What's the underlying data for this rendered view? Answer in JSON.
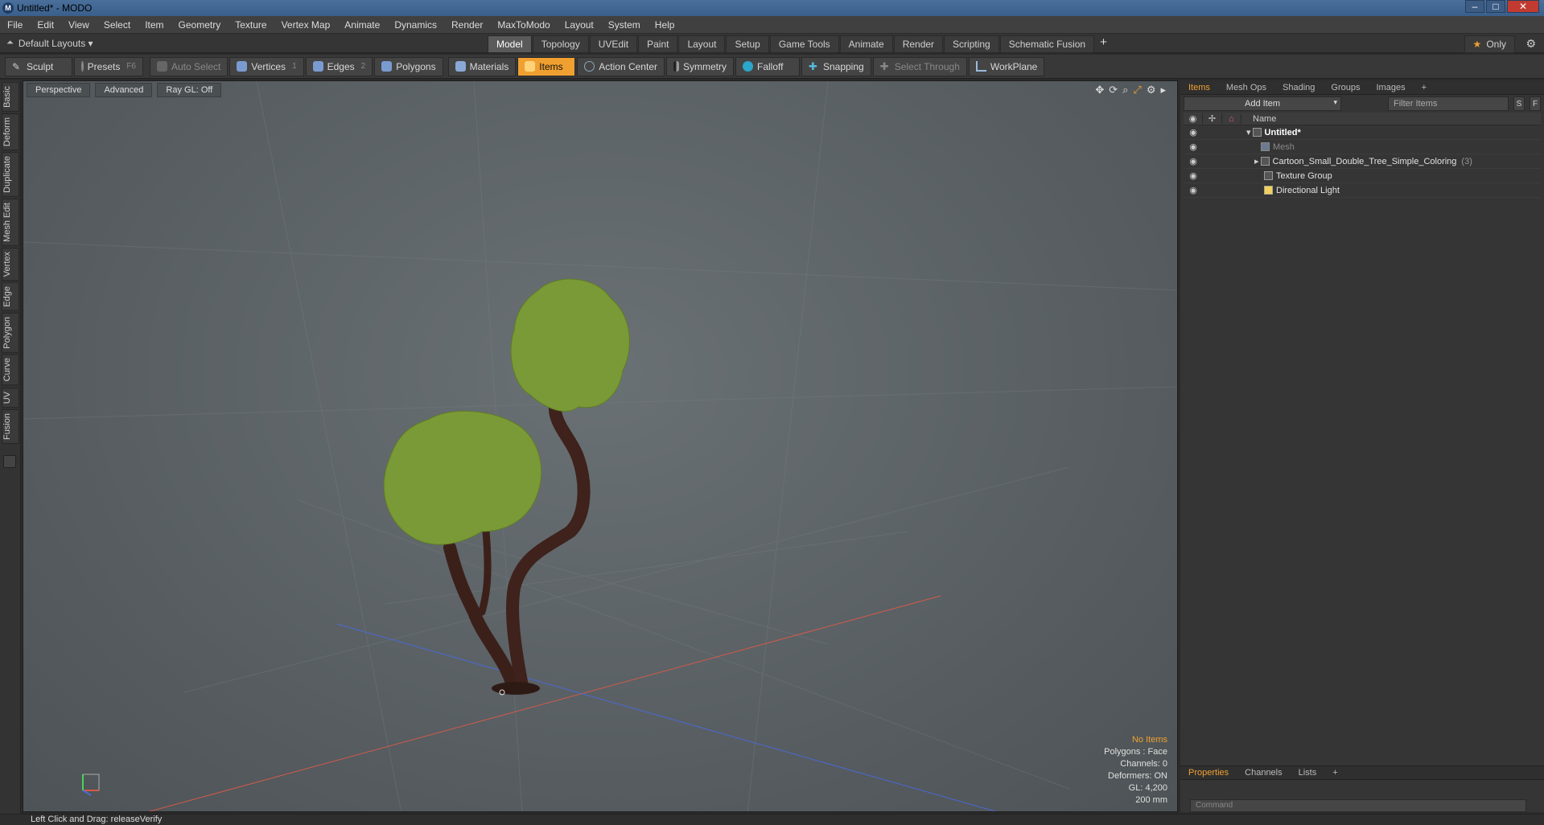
{
  "window": {
    "title": "Untitled* - MODO",
    "app_icon": "modo-logo-icon",
    "minimize": "–",
    "maximize": "□",
    "close": "✕"
  },
  "menu": [
    "File",
    "Edit",
    "View",
    "Select",
    "Item",
    "Geometry",
    "Texture",
    "Vertex Map",
    "Animate",
    "Dynamics",
    "Render",
    "MaxToModo",
    "Layout",
    "System",
    "Help"
  ],
  "layout": {
    "layouts_label": "Default Layouts",
    "tabs": [
      "Model",
      "Topology",
      "UVEdit",
      "Paint",
      "Layout",
      "Setup",
      "Game Tools",
      "Animate",
      "Render",
      "Scripting",
      "Schematic Fusion"
    ],
    "active_tab": "Model",
    "add_tab": "+",
    "only_label": "Only",
    "only_icon": "star-icon"
  },
  "toolbar": {
    "sculpt": "Sculpt",
    "presets": "Presets",
    "presets_key": "F6",
    "auto_select": "Auto Select",
    "vertices": "Vertices",
    "vertices_key": "1",
    "edges": "Edges",
    "edges_key": "2",
    "polygons": "Polygons",
    "materials": "Materials",
    "items": "Items",
    "action_center": "Action Center",
    "symmetry": "Symmetry",
    "falloff": "Falloff",
    "snapping": "Snapping",
    "select_through": "Select Through",
    "workplane": "WorkPlane"
  },
  "left_tabs": [
    "Basic",
    "Deform",
    "Duplicate",
    "Mesh Edit",
    "Vertex",
    "Edge",
    "Polygon",
    "Curve",
    "UV",
    "Fusion"
  ],
  "viewport": {
    "view_label": "Perspective",
    "advanced_label": "Advanced",
    "raygl_label": "Ray GL: Off",
    "icons": [
      "move-icon",
      "rotate-icon",
      "zoom-icon",
      "maximize-icon",
      "gear-icon",
      "arrow-right-icon"
    ],
    "stats": {
      "no_items": "No Items",
      "polygons": "Polygons : Face",
      "channels": "Channels: 0",
      "deformers": "Deformers: ON",
      "gl": "GL: 4,200",
      "scale": "200 mm"
    }
  },
  "right_panel": {
    "tabs": [
      "Items",
      "Mesh Ops",
      "Shading",
      "Groups",
      "Images"
    ],
    "active_tab": "Items",
    "add_tab": "+",
    "add_item": "Add Item",
    "filter_placeholder": "Filter Items",
    "s_button": "S",
    "f_button": "F",
    "name_col": "Name",
    "items": [
      {
        "label": "Untitled*",
        "count": ""
      },
      {
        "label": "Mesh",
        "count": ""
      },
      {
        "label": "Cartoon_Small_Double_Tree_Simple_Coloring",
        "count": "(3)"
      },
      {
        "label": "Texture Group",
        "count": ""
      },
      {
        "label": "Directional Light",
        "count": ""
      }
    ],
    "bottom_tabs": [
      "Properties",
      "Channels",
      "Lists"
    ],
    "bottom_add": "+",
    "command_placeholder": "Command"
  },
  "status": {
    "text": "Left Click and Drag:   releaseVerify"
  }
}
